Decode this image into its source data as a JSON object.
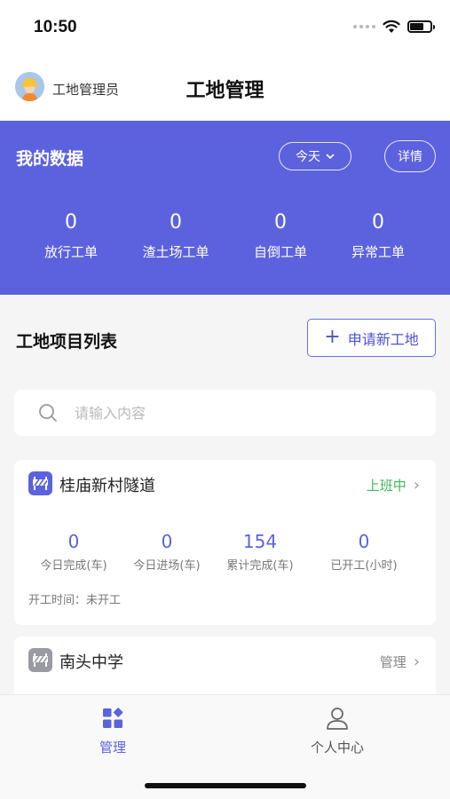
{
  "status_bar": {
    "time": "10:50"
  },
  "header": {
    "user_name": "工地管理员",
    "title": "工地管理"
  },
  "data_panel": {
    "title": "我的数据",
    "period": "今天",
    "detail": "详情",
    "stats": [
      {
        "value": "0",
        "label": "放行工单"
      },
      {
        "value": "0",
        "label": "渣土场工单"
      },
      {
        "value": "0",
        "label": "自倒工单"
      },
      {
        "value": "0",
        "label": "异常工单"
      }
    ]
  },
  "list": {
    "title": "工地项目列表",
    "apply_button": "申请新工地",
    "search_placeholder": "请输入内容"
  },
  "sites": [
    {
      "name": "桂庙新村隧道",
      "status": "上班中",
      "status_color": "#3cb95b",
      "stats": [
        {
          "value": "0",
          "label": "今日完成(车)"
        },
        {
          "value": "0",
          "label": "今日进场(车)"
        },
        {
          "value": "154",
          "label": "累计完成(车)"
        },
        {
          "value": "0",
          "label": "已开工(小时)"
        }
      ],
      "meta": "开工时间：未开工"
    },
    {
      "name": "南头中学",
      "status": "管理",
      "status_color": "#888888"
    }
  ],
  "tab_bar": {
    "tabs": [
      {
        "label": "管理",
        "icon": "grid-icon",
        "active": true
      },
      {
        "label": "个人中心",
        "icon": "person-icon",
        "active": false
      }
    ]
  },
  "colors": {
    "accent": "#5c62de",
    "working": "#3cb95b",
    "idle_icon": "#9a9aa3"
  }
}
